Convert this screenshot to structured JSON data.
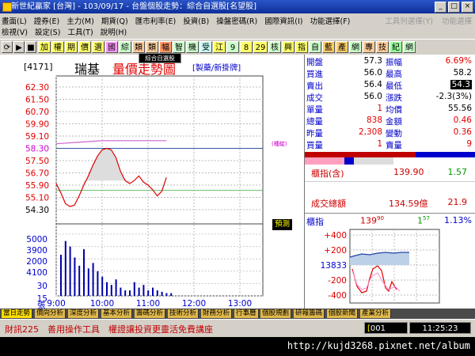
{
  "window": {
    "title": "新世紀贏家 [台灣] - 103/09/17 - 台盤個股走勢：綜合自選股[名望股]",
    "controls": [
      "_",
      "□",
      "×"
    ]
  },
  "menu": {
    "row1": [
      "畫面(L)",
      "證券(E)",
      "主力(M)",
      "期貨(Q)",
      "匯市利率(E)",
      "投資(B)",
      "操盤密碼(R)",
      "國際資訊(I)",
      "功能選擇(F)"
    ],
    "row2": [
      "檢視(V)",
      "設定(S)",
      "工具(T)",
      "說明(H)"
    ],
    "right": [
      "工具列選擇(Y)",
      "功能選擇"
    ]
  },
  "toolbar": {
    "buttons": [
      "加",
      "權",
      "期",
      "價",
      "選",
      "國",
      "綜",
      "類",
      "類",
      "幅",
      "智",
      "機",
      "受",
      "江",
      "9",
      "8",
      "29",
      "核",
      "興",
      "指",
      "自",
      "藍",
      "產",
      "網",
      "專",
      "技",
      "紀",
      "網"
    ],
    "tooltip": "綜合自選股"
  },
  "chart": {
    "code": "[4171]",
    "name": "瑞基",
    "title": "量價走勢圖",
    "tags": "[製藥/新掛牌]",
    "ref_label": "(種綻)",
    "badge": "預測",
    "unit_label": "張",
    "price_ticks": [
      "62.30",
      "61.50",
      "60.70",
      "59.90",
      "59.10",
      "58.30",
      "57.50",
      "56.70",
      "55.90",
      "55.10",
      "54.30"
    ],
    "volume_ticks": [
      "5000",
      "3900",
      "2000",
      "4100",
      "30",
      "15"
    ],
    "time_ticks": [
      "9:00",
      "10:00",
      "11:00",
      "12:00",
      "13:00"
    ]
  },
  "chart_data": {
    "type": "line",
    "price_axis": {
      "min": 54.3,
      "max": 62.3,
      "reference": 58.3,
      "avg_line": 55.56
    },
    "time_axis": {
      "start": "9:00",
      "end": "13:30"
    },
    "series": [
      {
        "x": [
          "9:00",
          "9:06",
          "9:12",
          "9:18",
          "9:24",
          "9:30",
          "9:36",
          "9:42",
          "9:48",
          "9:54",
          "10:00",
          "10:06",
          "10:12",
          "10:18",
          "10:24",
          "10:30",
          "10:36",
          "10:42",
          "10:48",
          "10:54",
          "11:00",
          "11:06",
          "11:12",
          "11:18",
          "11:24"
        ],
        "y": [
          56.0,
          55.4,
          54.7,
          54.5,
          54.6,
          55.2,
          55.9,
          56.5,
          57.2,
          57.8,
          58.2,
          58.3,
          58.2,
          57.7,
          56.8,
          56.2,
          56.0,
          56.2,
          56.5,
          56.1,
          55.9,
          55.6,
          55.2,
          55.5,
          56.4
        ]
      },
      {
        "x": [
          "9:00",
          "9:30",
          "10:00",
          "10:30",
          "11:00",
          "11:24"
        ],
        "y": [
          58.6,
          58.7,
          58.8,
          58.8,
          58.8,
          58.8
        ]
      }
    ],
    "volume": {
      "x": [
        "9:00",
        "9:06",
        "9:12",
        "9:18",
        "9:24",
        "9:30",
        "9:36",
        "9:42",
        "9:48",
        "9:54",
        "10:00",
        "10:06",
        "10:12",
        "10:18",
        "10:24",
        "10:30",
        "10:36",
        "10:42",
        "10:48",
        "10:54",
        "11:00",
        "11:06",
        "11:12",
        "11:18",
        "11:24"
      ],
      "values": [
        30,
        40,
        36,
        28,
        22,
        34,
        20,
        24,
        18,
        14,
        10,
        8,
        12,
        6,
        4,
        4,
        10,
        6,
        8,
        4,
        6,
        4,
        3,
        2,
        2
      ],
      "ylim": [
        0,
        45
      ]
    }
  },
  "quote": {
    "rows": [
      {
        "l1": "開盤",
        "v1": "57.3",
        "c1": "blk",
        "l2": "振幅",
        "v2": "6.69%",
        "c2": "red"
      },
      {
        "l1": "買進",
        "v1": "56.0",
        "c1": "blk",
        "l2": "最高",
        "v2": "58.2",
        "c2": "blk"
      },
      {
        "l1": "賣出",
        "v1": "56.4",
        "c1": "blk",
        "l2": "最低",
        "v2": "54.3",
        "c2": "inv"
      },
      {
        "l1": "成交",
        "v1": "56.0",
        "c1": "blk",
        "l2": "漲跌",
        "v2": "-2.3(3%)",
        "c2": "blk"
      },
      {
        "l1": "單量",
        "v1": "1",
        "c1": "red",
        "l2": "均價",
        "v2": "55.56",
        "c2": "blk"
      },
      {
        "l1": "總量",
        "v1": "838",
        "c1": "red",
        "l2": "金額",
        "v2": "0.46",
        "c2": "red"
      },
      {
        "l1": "昨量",
        "v1": "2,308",
        "c1": "red",
        "l2": "變動",
        "v2": "0.36",
        "c2": "red"
      },
      {
        "l1": "買量",
        "v1": "1",
        "c1": "red",
        "l2": "賣量",
        "v2": "9",
        "c2": "red"
      }
    ],
    "index_label": "櫃指(含)",
    "index_value": "139.90",
    "index_change": "1.57",
    "total_label": "成交總額",
    "total_value": "134.59億",
    "total_change": "21.9",
    "mini_title": "櫃指",
    "mini_value": "139",
    "mini_sup": "90",
    "mini_change": "1",
    "mini_change_sup": "57",
    "mini_pct": "1.13%",
    "mini_ticks": [
      "+400",
      "+200",
      "13833",
      "-200",
      "-400"
    ]
  },
  "tabs": [
    "當日走勢",
    "價向分析",
    "深度分析",
    "基本分析",
    "籌碼分析",
    "技術分析",
    "財務分析",
    "行事曆",
    "個股規劃",
    "研報籌碼",
    "個股新聞",
    "產業分析"
  ],
  "status": {
    "marquee": "財訊225　善用操作工具　權證讓投資更靈活免費講座",
    "code_box": "001",
    "clock": "11:25:23"
  },
  "url": "http://kujd3268.pixnet.net/album"
}
